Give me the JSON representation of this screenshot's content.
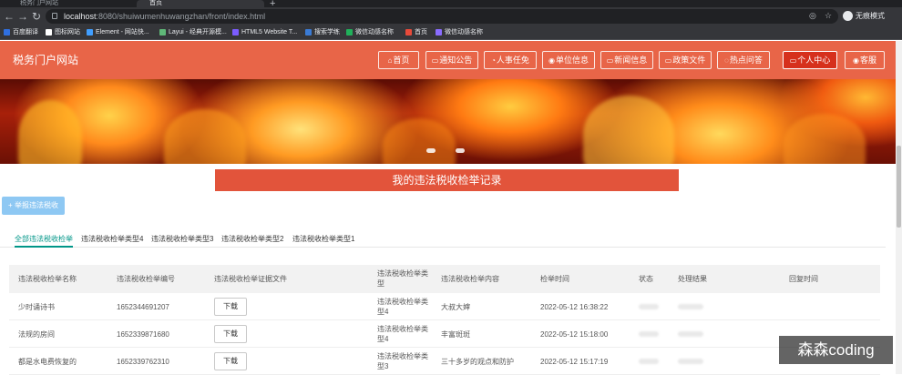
{
  "browser": {
    "tabs": [
      {
        "label": "税务门户网站",
        "active": false
      },
      {
        "label": "首页",
        "active": true
      }
    ],
    "url_host": "localhost",
    "url_rest": ":8080/shuiwumenhuwangzhan/front/index.html",
    "profile_label": "无痕模式",
    "bookmarks": [
      {
        "label": "百度翻译",
        "color": "#2f6fe0"
      },
      {
        "label": "图标网站",
        "color": "#ffffff"
      },
      {
        "label": "Element - 网站快...",
        "color": "#409eff"
      },
      {
        "label": "Layui - 经典开源模...",
        "color": "#5fb878"
      },
      {
        "label": "HTML5 Website T...",
        "color": "#7b5cff"
      },
      {
        "label": "搜索学练",
        "color": "#3a7bd5"
      },
      {
        "label": "微信动感名称",
        "color": "#20b05a"
      },
      {
        "label": "首页",
        "color": "#e84a3a"
      },
      {
        "label": "微信动感名称",
        "color": "#8a6cff"
      }
    ]
  },
  "site": {
    "title": "税务门户网站",
    "nav": [
      {
        "label": "首页",
        "icon": "home-icon",
        "glyph": "⌂",
        "active": false
      },
      {
        "label": "通知公告",
        "icon": "notice-icon",
        "glyph": "▭",
        "active": false
      },
      {
        "label": "人事任免",
        "icon": "person-icon",
        "glyph": "◔",
        "active": false
      },
      {
        "label": "单位信息",
        "icon": "info-icon",
        "glyph": "◉",
        "active": false
      },
      {
        "label": "新闻信息",
        "icon": "news-icon",
        "glyph": "▭",
        "active": false
      },
      {
        "label": "政策文件",
        "icon": "document-icon",
        "glyph": "▭",
        "active": false
      },
      {
        "label": "热点问答",
        "icon": "qa-icon",
        "glyph": "◌",
        "active": false
      },
      {
        "label": "个人中心",
        "icon": "user-center-icon",
        "glyph": "▭",
        "active": true
      },
      {
        "label": "客服",
        "icon": "service-icon",
        "glyph": "◉",
        "active": false
      }
    ],
    "accent": "#e86548",
    "active_nav_color": "#d6301c"
  },
  "main": {
    "heading": "我的违法税收检举记录",
    "add_button": "+ 举报违法税收",
    "tabs": [
      {
        "label": "全部违法税收检举",
        "active": true
      },
      {
        "label": "违法税收检举类型4",
        "active": false
      },
      {
        "label": "违法税收检举类型3",
        "active": false
      },
      {
        "label": "违法税收检举类型2",
        "active": false
      },
      {
        "label": "违法税收检举类型1",
        "active": false
      }
    ],
    "table": {
      "columns": [
        "违法税收检举名称",
        "违法税收检举编号",
        "违法税收检举证据文件",
        "违法税收检举类\n型",
        "违法税收检举内容",
        "检举时间",
        "状态",
        "处理结果",
        "回复时间"
      ],
      "rows": [
        {
          "name": "少时诵诗书",
          "code": "1652344691207",
          "file_button": "下载",
          "type": "违法税收检举类\n型4",
          "content": "大叔大婶",
          "time": "2022-05-12 16:38:22"
        },
        {
          "name": "法规的房间",
          "code": "1652339871680",
          "file_button": "下载",
          "type": "违法税收检举类\n型4",
          "content": "丰富斑斑",
          "time": "2022-05-12 15:18:00"
        },
        {
          "name": "都是水电费恢复的",
          "code": "1652339762310",
          "file_button": "下载",
          "type": "违法税收检举类\n型3",
          "content": "三十多岁的观点和防护",
          "time": "2022-05-12 15:17:19"
        }
      ]
    }
  },
  "watermark": "森森coding"
}
